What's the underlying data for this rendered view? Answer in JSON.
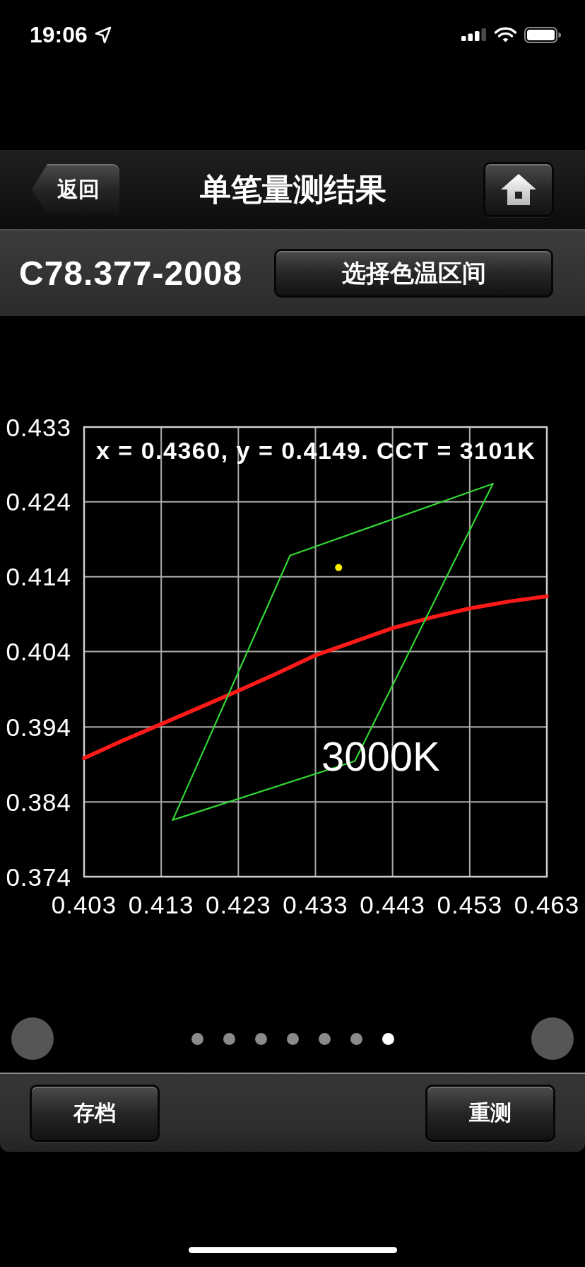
{
  "status_bar": {
    "time": "19:06"
  },
  "nav_bar": {
    "back_button": "返回",
    "title": "单笔量测结果"
  },
  "standard_bar": {
    "standard": "C78.377-2008",
    "range_button": "选择色温区间"
  },
  "chart": {
    "chart_data": {
      "type": "line",
      "grid": true,
      "xlim": [
        0.403,
        0.463
      ],
      "ylim": [
        0.374,
        0.4335
      ],
      "xticks": [
        0.403,
        0.413,
        0.423,
        0.433,
        0.443,
        0.453,
        0.463
      ],
      "yticks": [
        {
          "value": 0.374,
          "label": "0.374"
        },
        {
          "value": 0.3839,
          "label": "0.384"
        },
        {
          "value": 0.3938,
          "label": "0.394"
        },
        {
          "value": 0.4038,
          "label": "0.404"
        },
        {
          "value": 0.4137,
          "label": "0.414"
        },
        {
          "value": 0.4236,
          "label": "0.424"
        },
        {
          "value": 0.4335,
          "label": "0.433"
        }
      ],
      "series": [
        {
          "color": "#ff1a1a",
          "x": [
            0.403,
            0.408,
            0.413,
            0.418,
            0.423,
            0.428,
            0.433,
            0.438,
            0.443,
            0.448,
            0.453,
            0.458,
            0.463
          ],
          "values": [
            0.3897,
            0.392,
            0.3942,
            0.3964,
            0.3986,
            0.4009,
            0.4033,
            0.4051,
            0.4069,
            0.4083,
            0.4095,
            0.4104,
            0.4111
          ]
        },
        {
          "color": "#33d633",
          "x": [
            0.4145,
            0.4297,
            0.456
          ],
          "values": [
            0.3815,
            0.4165,
            0.426
          ]
        },
        {
          "color": "#33d633",
          "x": [
            0.4145,
            0.4381,
            0.456
          ],
          "values": [
            0.3815,
            0.3893,
            0.426
          ]
        },
        {
          "color": "#ffee00",
          "marker": "circle",
          "x": [
            0.436
          ],
          "values": [
            0.4149
          ]
        }
      ],
      "annotations": [
        "x = 0.4360, y = 0.4149. CCT = 3101K",
        "3000K"
      ]
    }
  },
  "pager": {
    "page_dots": [
      {
        "selected": false
      },
      {
        "selected": false
      },
      {
        "selected": false
      },
      {
        "selected": false
      },
      {
        "selected": false
      },
      {
        "selected": false
      },
      {
        "selected": true
      }
    ]
  },
  "bottom_bar": {
    "buttons": [
      "存档",
      "重测"
    ]
  }
}
